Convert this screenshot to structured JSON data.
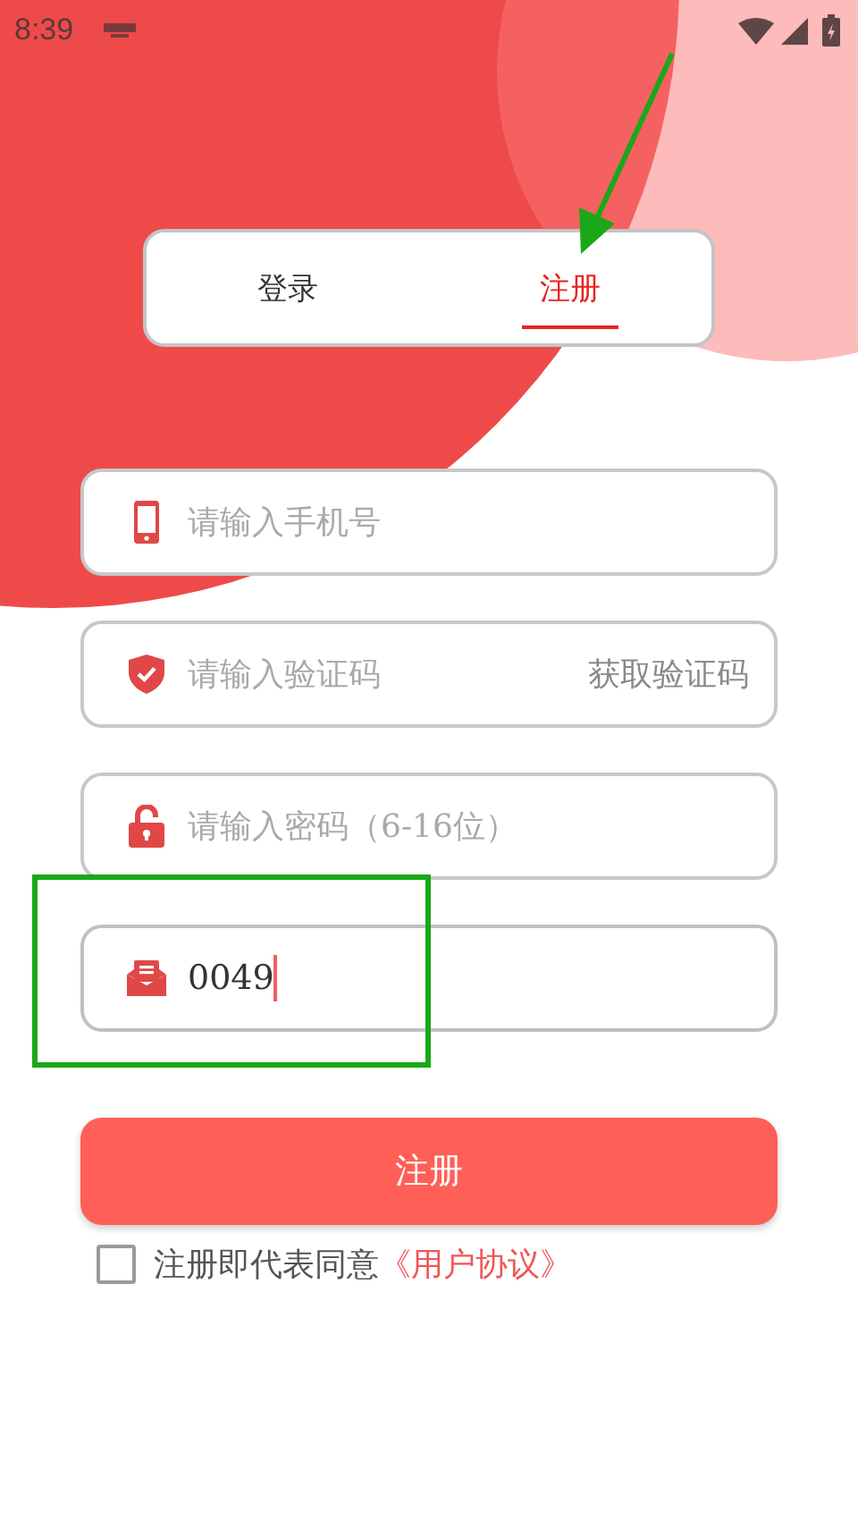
{
  "status_bar": {
    "time": "8:39"
  },
  "tabs": [
    {
      "label": "登录",
      "selected": false
    },
    {
      "label": "注册",
      "selected": true
    }
  ],
  "fields": [
    {
      "kind": "phone",
      "placeholder": "请输入手机号"
    },
    {
      "kind": "code",
      "placeholder": "请输入验证码",
      "action": "获取验证码"
    },
    {
      "kind": "password",
      "placeholder": "请输入密码（6-16位）"
    },
    {
      "kind": "invite",
      "value": "0049",
      "focused": true
    }
  ],
  "submit": "注册",
  "agreement": {
    "checked": false,
    "text": "注册即代表同意",
    "link": "《用户协议》"
  }
}
